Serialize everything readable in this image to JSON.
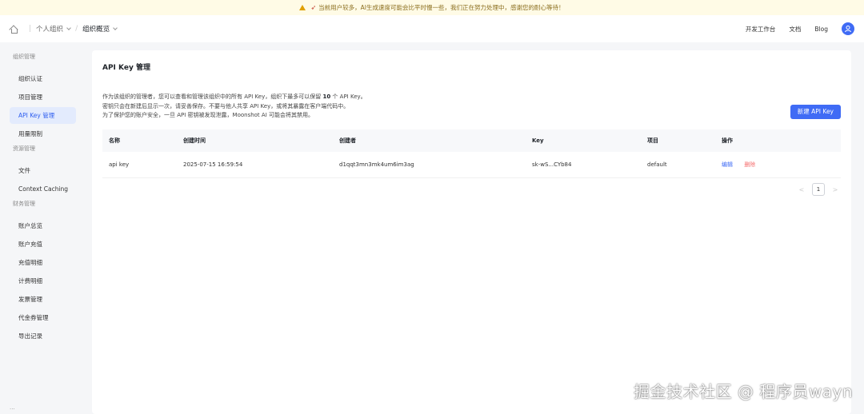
{
  "notice": {
    "text": "当前用户较多，AI生成速度可能会比平时慢一些，我们正在努力处理中，感谢您的耐心等待！"
  },
  "breadcrumb": {
    "org": "个人组织",
    "page": "组织概览"
  },
  "header": {
    "links": [
      "开发工作台",
      "文档",
      "Blog"
    ]
  },
  "sidebar": {
    "groups": [
      {
        "title": "组织管理",
        "items": [
          "组织认证",
          "项目管理",
          "API Key 管理",
          "用量限制"
        ]
      },
      {
        "title": "资源管理",
        "items": [
          "文件",
          "Context Caching"
        ]
      },
      {
        "title": "财务管理",
        "items": [
          "账户总览",
          "账户充值",
          "充值明细",
          "计费明细",
          "发票管理",
          "代金券管理",
          "导出记录"
        ]
      }
    ],
    "active": "API Key 管理"
  },
  "card": {
    "title": "API Key 管理",
    "desc1_pre": "作为该组织的管理者，您可以查看和管理该组织中的所有 API Key，组织下最多可以保留 ",
    "desc1_num": "10",
    "desc1_post": " 个 API Key。",
    "desc2": "密钥只会在新建后显示一次，请妥善保存。不要与他人共享 API Key，或将其暴露在客户端代码中。",
    "desc3": "为了保护您的账户安全，一旦 API 密钥被发现泄露，Moonshot AI 可能会将其禁用。",
    "new_button": "新建 API Key"
  },
  "table": {
    "headers": [
      "名称",
      "创建时间",
      "创建者",
      "Key",
      "项目",
      "操作"
    ],
    "rows": [
      {
        "name": "api key",
        "created": "2025-07-15 16:59:54",
        "creator": "d1qqt3mn3mk4um6im3ag",
        "key": "sk-wS...CYb84",
        "project": "default",
        "edit": "编辑",
        "delete": "删除"
      }
    ]
  },
  "pagination": {
    "current": "1",
    "prev": "<",
    "next": ">"
  },
  "watermark": "掘金技术社区 @ 程序员wayn",
  "colors": {
    "primary": "#3f6bf5",
    "danger": "#f56c6c",
    "notice_bg": "#fffbe6"
  }
}
